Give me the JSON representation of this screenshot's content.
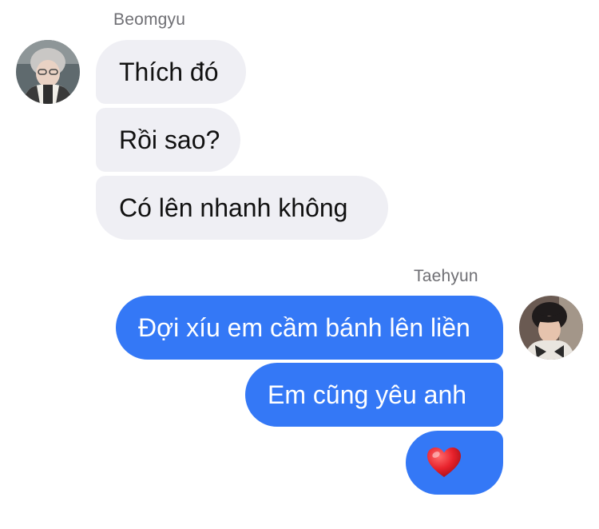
{
  "conversation": {
    "incoming": {
      "sender": "Beomgyu",
      "avatar_icon": "user-avatar-icon",
      "messages": [
        "Thích đó",
        "Rồi sao?",
        "Có lên nhanh không"
      ]
    },
    "outgoing": {
      "sender": "Taehyun",
      "avatar_icon": "user-avatar-icon",
      "messages": [
        "Đợi xíu em cầm bánh lên liền",
        "Em cũng yêu anh"
      ],
      "reaction": "❤️"
    }
  },
  "colors": {
    "incoming_bubble": "#efeff4",
    "outgoing_bubble": "#3478f6",
    "heart": "#e8222c"
  }
}
